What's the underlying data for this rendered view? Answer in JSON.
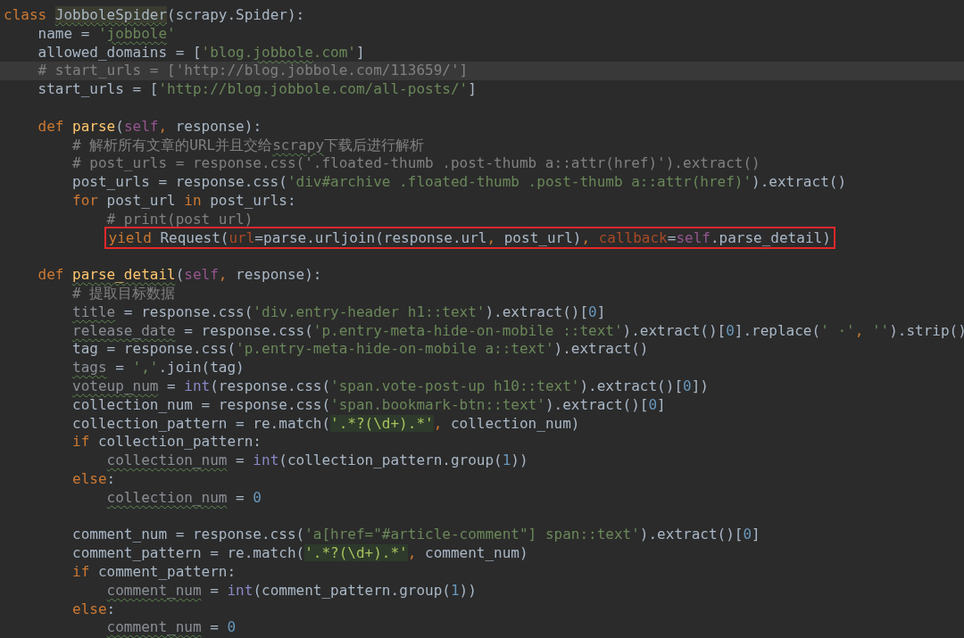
{
  "editor": {
    "lines": [
      {
        "current": false,
        "boxed": false,
        "tokens": [
          {
            "text": "class ",
            "kind": "keyword"
          },
          {
            "text": "JobboleSpider",
            "kind": "classname"
          },
          {
            "text": "(scrapy.Spider):",
            "kind": "plain"
          }
        ],
        "children": [
          {
            "current": false,
            "boxed": false,
            "tokens": [
              {
                "text": "name = ",
                "kind": "plain"
              },
              {
                "text": "'",
                "kind": "string"
              },
              {
                "text": "jobbole",
                "kind": "string_typo"
              },
              {
                "text": "'",
                "kind": "string"
              }
            ]
          },
          {
            "current": false,
            "boxed": false,
            "tokens": [
              {
                "text": "allowed_domains = [",
                "kind": "plain"
              },
              {
                "text": "'blog.",
                "kind": "string"
              },
              {
                "text": "jobbole",
                "kind": "string_typo"
              },
              {
                "text": ".com'",
                "kind": "string"
              },
              {
                "text": "]",
                "kind": "plain"
              }
            ]
          },
          {
            "current": true,
            "boxed": false,
            "tokens": [
              {
                "text": "# start_urls = ['http://blog.jobbole.com/113659/']",
                "kind": "comment"
              }
            ]
          },
          {
            "current": false,
            "boxed": false,
            "tokens": [
              {
                "text": "start_urls = [",
                "kind": "plain"
              },
              {
                "text": "'http://blog.jobbole.com/all-posts/'",
                "kind": "string"
              },
              {
                "text": "]",
                "kind": "plain"
              }
            ]
          },
          {
            "current": false,
            "boxed": false
          },
          {
            "current": false,
            "boxed": false,
            "tokens": [
              {
                "text": "def ",
                "kind": "keyword"
              },
              {
                "text": "parse",
                "kind": "function"
              },
              {
                "text": "(",
                "kind": "plain"
              },
              {
                "text": "self",
                "kind": "self"
              },
              {
                "text": ",",
                "kind": "keyword"
              },
              {
                "text": " response):",
                "kind": "plain"
              }
            ],
            "children": [
              {
                "current": false,
                "boxed": false,
                "tokens": [
                  {
                    "text": "# 解析所有文章的URL并且交给",
                    "kind": "comment"
                  },
                  {
                    "text": "scrapy",
                    "kind": "comment_typo"
                  },
                  {
                    "text": "下载后进行解析",
                    "kind": "comment"
                  }
                ]
              },
              {
                "current": false,
                "boxed": false,
                "tokens": [
                  {
                    "text": "# post_urls = response.css('.floated-thumb .post-thumb a::attr(href)').extract()",
                    "kind": "comment"
                  }
                ]
              },
              {
                "current": false,
                "boxed": false,
                "tokens": [
                  {
                    "text": "post_urls = response.css(",
                    "kind": "plain"
                  },
                  {
                    "text": "'div#archive .floated-thumb .post-thumb a::attr(href)'",
                    "kind": "string"
                  },
                  {
                    "text": ").extract()",
                    "kind": "plain"
                  }
                ]
              },
              {
                "current": false,
                "boxed": false,
                "tokens": [
                  {
                    "text": "for ",
                    "kind": "keyword"
                  },
                  {
                    "text": "post_url ",
                    "kind": "plain"
                  },
                  {
                    "text": "in ",
                    "kind": "keyword"
                  },
                  {
                    "text": "post_urls:",
                    "kind": "plain"
                  }
                ],
                "children": [
                  {
                    "current": false,
                    "boxed": false,
                    "tokens": [
                      {
                        "text": "# print(post_url)",
                        "kind": "comment"
                      }
                    ]
                  },
                  {
                    "current": false,
                    "boxed": true,
                    "tokens": [
                      {
                        "text": "yield ",
                        "kind": "keyword"
                      },
                      {
                        "text": "Request(",
                        "kind": "plain"
                      },
                      {
                        "text": "url",
                        "kind": "param"
                      },
                      {
                        "text": "=parse.urljoin(response.url",
                        "kind": "plain"
                      },
                      {
                        "text": ",",
                        "kind": "keyword"
                      },
                      {
                        "text": " post_url)",
                        "kind": "plain"
                      },
                      {
                        "text": ", ",
                        "kind": "keyword"
                      },
                      {
                        "text": "callback",
                        "kind": "param"
                      },
                      {
                        "text": "=",
                        "kind": "plain"
                      },
                      {
                        "text": "self",
                        "kind": "self"
                      },
                      {
                        "text": ".parse_detail)",
                        "kind": "plain"
                      }
                    ]
                  }
                ]
              }
            ]
          },
          {
            "current": false,
            "boxed": false
          },
          {
            "current": false,
            "boxed": false,
            "tokens": [
              {
                "text": "def ",
                "kind": "keyword"
              },
              {
                "text": "parse_detail",
                "kind": "function_typo"
              },
              {
                "text": "(",
                "kind": "plain"
              },
              {
                "text": "self",
                "kind": "self"
              },
              {
                "text": ",",
                "kind": "keyword"
              },
              {
                "text": " response):",
                "kind": "plain"
              }
            ],
            "children": [
              {
                "current": false,
                "boxed": false,
                "tokens": [
                  {
                    "text": "# 提取目标数据",
                    "kind": "comment"
                  }
                ]
              },
              {
                "current": false,
                "boxed": false,
                "tokens": [
                  {
                    "text": "title",
                    "kind": "unused_typo"
                  },
                  {
                    "text": " = response.css(",
                    "kind": "plain"
                  },
                  {
                    "text": "'div.entry-header h1::text'",
                    "kind": "string"
                  },
                  {
                    "text": ").extract()[",
                    "kind": "plain"
                  },
                  {
                    "text": "0",
                    "kind": "number"
                  },
                  {
                    "text": "]",
                    "kind": "plain"
                  }
                ]
              },
              {
                "current": false,
                "boxed": false,
                "tokens": [
                  {
                    "text": "release_date",
                    "kind": "unused_typo"
                  },
                  {
                    "text": " = response.css(",
                    "kind": "plain"
                  },
                  {
                    "text": "'p.entry-meta-hide-on-mobile ::text'",
                    "kind": "string"
                  },
                  {
                    "text": ").extract()[",
                    "kind": "plain"
                  },
                  {
                    "text": "0",
                    "kind": "number"
                  },
                  {
                    "text": "].replace(",
                    "kind": "plain"
                  },
                  {
                    "text": "' ·'",
                    "kind": "string"
                  },
                  {
                    "text": ", ",
                    "kind": "keyword"
                  },
                  {
                    "text": "''",
                    "kind": "string"
                  },
                  {
                    "text": ").strip()",
                    "kind": "plain"
                  }
                ]
              },
              {
                "current": false,
                "boxed": false,
                "tokens": [
                  {
                    "text": "tag = response.css(",
                    "kind": "plain"
                  },
                  {
                    "text": "'p.entry-meta-hide-on-mobile a::text'",
                    "kind": "string"
                  },
                  {
                    "text": ").extract()",
                    "kind": "plain"
                  }
                ]
              },
              {
                "current": false,
                "boxed": false,
                "tokens": [
                  {
                    "text": "tags",
                    "kind": "unused_typo"
                  },
                  {
                    "text": " = ",
                    "kind": "plain"
                  },
                  {
                    "text": "','",
                    "kind": "string"
                  },
                  {
                    "text": ".join(tag)",
                    "kind": "plain"
                  }
                ]
              },
              {
                "current": false,
                "boxed": false,
                "tokens": [
                  {
                    "text": "voteup_num",
                    "kind": "unused_typo"
                  },
                  {
                    "text": " = ",
                    "kind": "plain"
                  },
                  {
                    "text": "int",
                    "kind": "builtin"
                  },
                  {
                    "text": "(response.css(",
                    "kind": "plain"
                  },
                  {
                    "text": "'span.vote-post-up h10::text'",
                    "kind": "string"
                  },
                  {
                    "text": ").extract()[",
                    "kind": "plain"
                  },
                  {
                    "text": "0",
                    "kind": "number"
                  },
                  {
                    "text": "])",
                    "kind": "plain"
                  }
                ]
              },
              {
                "current": false,
                "boxed": false,
                "tokens": [
                  {
                    "text": "collection_num = response.css(",
                    "kind": "plain"
                  },
                  {
                    "text": "'span.bookmark-btn::text'",
                    "kind": "string"
                  },
                  {
                    "text": ").extract()[",
                    "kind": "plain"
                  },
                  {
                    "text": "0",
                    "kind": "number"
                  },
                  {
                    "text": "]",
                    "kind": "plain"
                  }
                ]
              },
              {
                "current": false,
                "boxed": false,
                "tokens": [
                  {
                    "text": "collection_pattern = re.match(",
                    "kind": "plain"
                  },
                  {
                    "text": "'.*?(\\d+).*'",
                    "kind": "regex"
                  },
                  {
                    "text": ",",
                    "kind": "keyword"
                  },
                  {
                    "text": " collection_num)",
                    "kind": "plain"
                  }
                ]
              },
              {
                "current": false,
                "boxed": false,
                "tokens": [
                  {
                    "text": "if ",
                    "kind": "keyword"
                  },
                  {
                    "text": "collection_pattern:",
                    "kind": "plain"
                  }
                ],
                "children": [
                  {
                    "current": false,
                    "boxed": false,
                    "tokens": [
                      {
                        "text": "collection_num",
                        "kind": "unused_typo"
                      },
                      {
                        "text": " = ",
                        "kind": "plain"
                      },
                      {
                        "text": "int",
                        "kind": "builtin"
                      },
                      {
                        "text": "(collection_pattern.group(",
                        "kind": "plain"
                      },
                      {
                        "text": "1",
                        "kind": "number"
                      },
                      {
                        "text": "))",
                        "kind": "plain"
                      }
                    ]
                  }
                ]
              },
              {
                "current": false,
                "boxed": false,
                "tokens": [
                  {
                    "text": "else",
                    "kind": "keyword"
                  },
                  {
                    "text": ":",
                    "kind": "plain"
                  }
                ],
                "children": [
                  {
                    "current": false,
                    "boxed": false,
                    "tokens": [
                      {
                        "text": "collection_num",
                        "kind": "unused_typo"
                      },
                      {
                        "text": " = ",
                        "kind": "plain"
                      },
                      {
                        "text": "0",
                        "kind": "number"
                      }
                    ]
                  }
                ]
              },
              {
                "current": false,
                "boxed": false
              },
              {
                "current": false,
                "boxed": false,
                "tokens": [
                  {
                    "text": "comment_num = response.css(",
                    "kind": "plain"
                  },
                  {
                    "text": "'a[href=\"#article-comment\"] span::text'",
                    "kind": "string"
                  },
                  {
                    "text": ").extract()[",
                    "kind": "plain"
                  },
                  {
                    "text": "0",
                    "kind": "number"
                  },
                  {
                    "text": "]",
                    "kind": "plain"
                  }
                ]
              },
              {
                "current": false,
                "boxed": false,
                "tokens": [
                  {
                    "text": "comment_pattern = re.match(",
                    "kind": "plain"
                  },
                  {
                    "text": "'.*?(\\d+).*'",
                    "kind": "regex"
                  },
                  {
                    "text": ",",
                    "kind": "keyword"
                  },
                  {
                    "text": " comment_num)",
                    "kind": "plain"
                  }
                ]
              },
              {
                "current": false,
                "boxed": false,
                "tokens": [
                  {
                    "text": "if ",
                    "kind": "keyword"
                  },
                  {
                    "text": "comment_pattern:",
                    "kind": "plain"
                  }
                ],
                "children": [
                  {
                    "current": false,
                    "boxed": false,
                    "tokens": [
                      {
                        "text": "comment_num",
                        "kind": "unused_typo"
                      },
                      {
                        "text": " = ",
                        "kind": "plain"
                      },
                      {
                        "text": "int",
                        "kind": "builtin"
                      },
                      {
                        "text": "(comment_pattern.group(",
                        "kind": "plain"
                      },
                      {
                        "text": "1",
                        "kind": "number"
                      },
                      {
                        "text": "))",
                        "kind": "plain"
                      }
                    ]
                  }
                ]
              },
              {
                "current": false,
                "boxed": false,
                "tokens": [
                  {
                    "text": "else",
                    "kind": "keyword"
                  },
                  {
                    "text": ":",
                    "kind": "plain"
                  }
                ],
                "children": [
                  {
                    "current": false,
                    "boxed": false,
                    "tokens": [
                      {
                        "text": "comment_num",
                        "kind": "unused_typo"
                      },
                      {
                        "text": " = ",
                        "kind": "plain"
                      },
                      {
                        "text": "0",
                        "kind": "number"
                      }
                    ]
                  }
                ]
              }
            ]
          }
        ]
      }
    ]
  }
}
